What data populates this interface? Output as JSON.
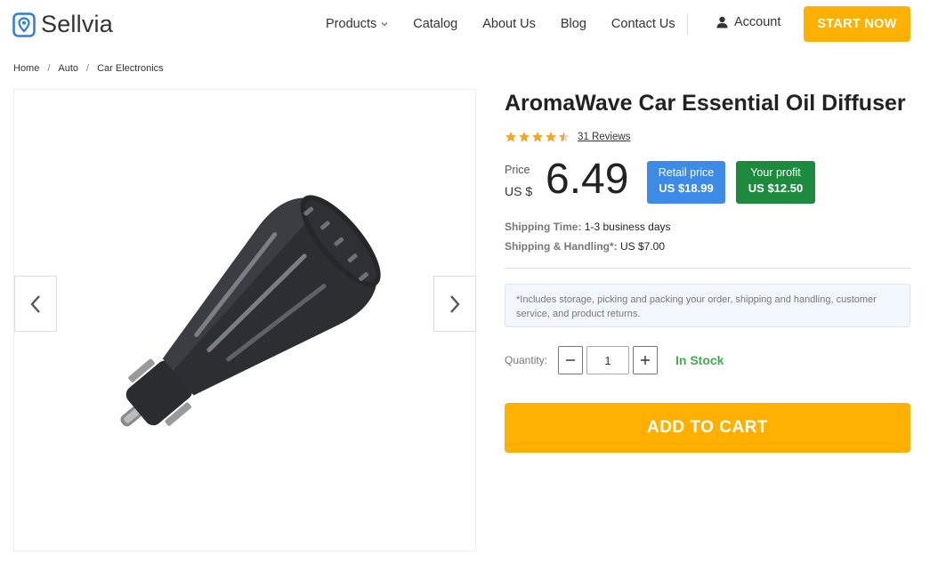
{
  "brand": {
    "name": "Sellvia"
  },
  "nav": {
    "products": "Products",
    "catalog": "Catalog",
    "about": "About Us",
    "blog": "Blog",
    "contact": "Contact Us",
    "account": "Account",
    "start": "START NOW"
  },
  "breadcrumb": [
    "Home",
    "Auto",
    "Car Electronics"
  ],
  "product": {
    "title": "AromaWave Car Essential Oil Diffuser",
    "rating": 4.5,
    "reviews": "31 Reviews",
    "price_label": "Price",
    "currency": "US $",
    "price": "6.49",
    "retail_label": "Retail price",
    "retail_value": "US $18.99",
    "profit_label": "Your profit",
    "profit_value": "US $12.50",
    "shipping_time_label": "Shipping Time:",
    "shipping_time_value": "1-3 business days",
    "shipping_handling_label": "Shipping & Handling*:",
    "shipping_handling_value": "US $7.00",
    "note": "*Includes storage, picking and packing your order, shipping and handling, customer service, and product returns.",
    "quantity_label": "Quantity:",
    "quantity": "1",
    "stock_status": "In Stock",
    "add_to_cart": "ADD TO CART"
  },
  "colors": {
    "accent": "#ffb000",
    "retail_badge": "#3d8be6",
    "profit_badge": "#1e8a3e",
    "in_stock": "#3db24a",
    "logo": "#2f7fd4",
    "star": "#f5a623"
  },
  "icons": [
    "location-pin-logo-icon",
    "chevron-down-icon",
    "user-icon",
    "star-icon",
    "chevron-left-icon",
    "chevron-right-icon",
    "minus-icon",
    "plus-icon"
  ]
}
